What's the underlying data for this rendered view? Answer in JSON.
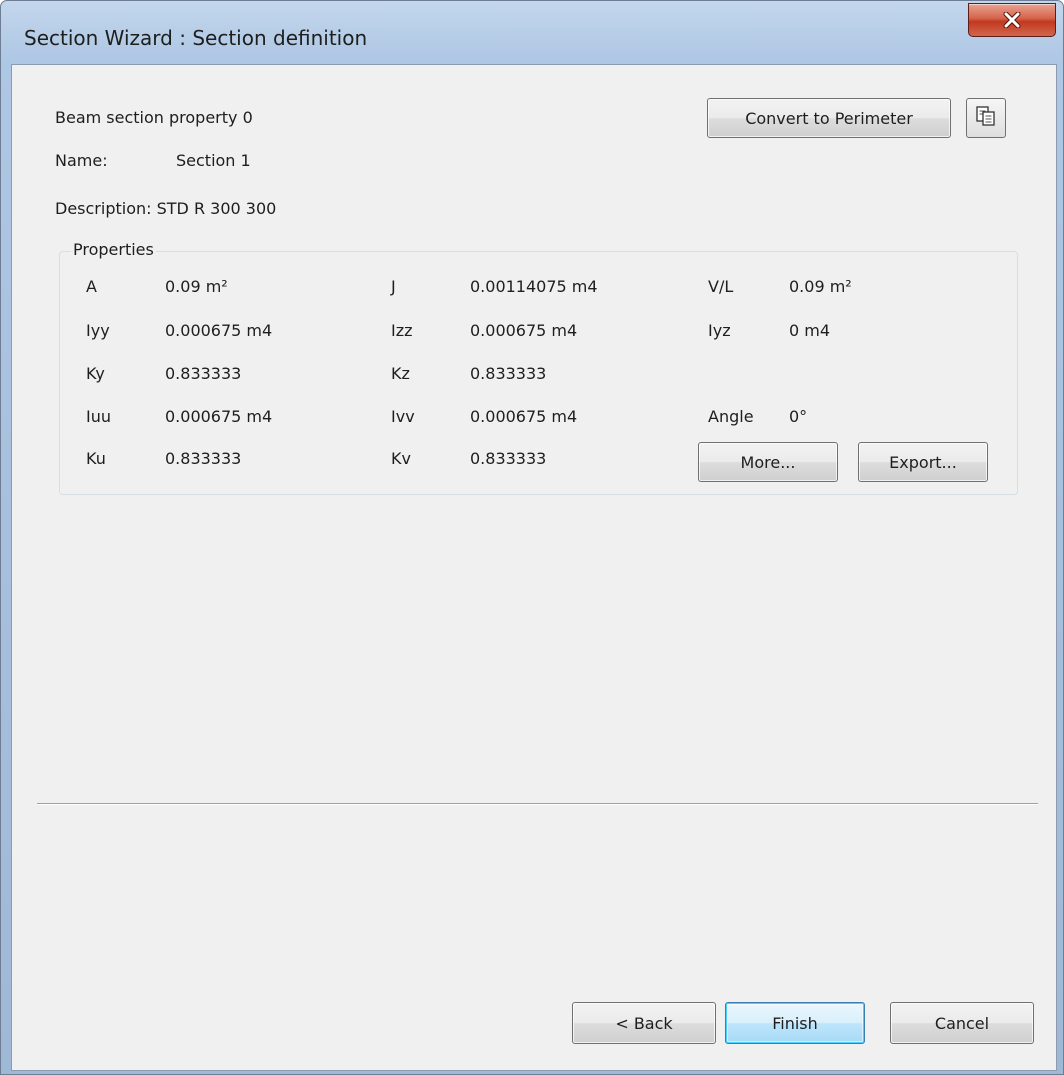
{
  "window": {
    "title": "Section Wizard : Section definition",
    "close_icon": "close-x-icon"
  },
  "header": {
    "property_label": "Beam section property 0",
    "name_label": "Name:",
    "name_value": "Section 1",
    "description_text": "Description: STD R 300 300",
    "convert_button": "Convert to Perimeter",
    "copy_icon": "copy-icon"
  },
  "properties": {
    "group_title": "Properties",
    "rows": [
      {
        "label1": "A",
        "value1": "0.09 m²",
        "label2": "J",
        "value2": "0.00114075 m4",
        "label3": "V/L",
        "value3": "0.09 m²"
      },
      {
        "label1": "Iyy",
        "value1": "0.000675 m4",
        "label2": "Izz",
        "value2": "0.000675 m4",
        "label3": "Iyz",
        "value3": "0 m4"
      },
      {
        "label1": "Ky",
        "value1": "0.833333",
        "label2": "Kz",
        "value2": "0.833333",
        "label3": "",
        "value3": ""
      },
      {
        "label1": "Iuu",
        "value1": "0.000675 m4",
        "label2": "Ivv",
        "value2": "0.000675 m4",
        "label3": "Angle",
        "value3": "0°"
      },
      {
        "label1": "Ku",
        "value1": "0.833333",
        "label2": "Kv",
        "value2": "0.833333",
        "label3": "",
        "value3": ""
      }
    ],
    "more_button": "More...",
    "export_button": "Export..."
  },
  "footer": {
    "back_button": "< Back",
    "finish_button": "Finish",
    "cancel_button": "Cancel"
  }
}
